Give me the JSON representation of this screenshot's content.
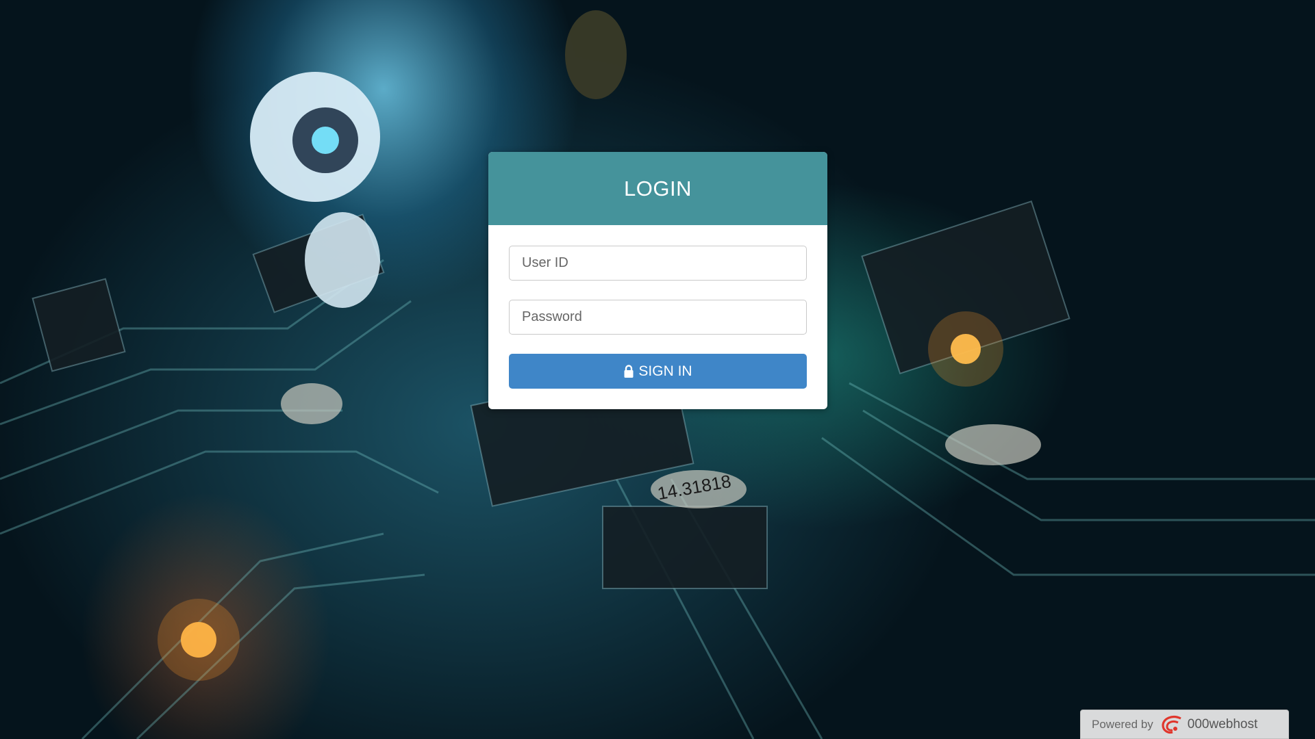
{
  "login": {
    "title": "LOGIN",
    "user_id_placeholder": "User ID",
    "password_placeholder": "Password",
    "sign_in_label": "SIGN IN"
  },
  "footer_badge": {
    "powered_by": "Powered by",
    "brand": "000webhost",
    "brand_icon": "000webhost-logo-icon"
  },
  "colors": {
    "header": "#45939b",
    "button": "#3f86c8",
    "card": "#ffffff"
  },
  "icons": {
    "sign_in": "lock-icon"
  }
}
